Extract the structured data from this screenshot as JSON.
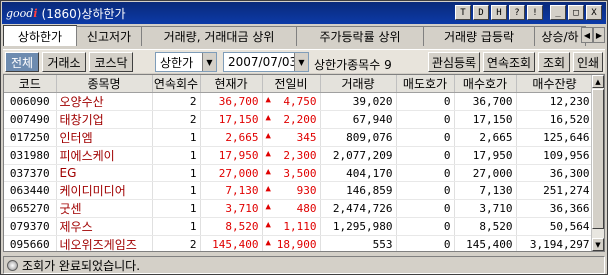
{
  "window": {
    "logo_prefix": "good",
    "logo_suffix": "i",
    "title": "(1860)상하한가",
    "buttons": [
      "T",
      "D",
      "H",
      "?",
      "!",
      "_",
      "□",
      "X"
    ]
  },
  "tabs": [
    {
      "label": "상하한가",
      "active": true
    },
    {
      "label": "신고저가",
      "active": false
    },
    {
      "label": "거래량, 거래대금 상위",
      "active": false
    },
    {
      "label": "주가등락률 상위",
      "active": false
    },
    {
      "label": "거래량 급등락",
      "active": false
    },
    {
      "label": "상승/하",
      "active": false
    }
  ],
  "toolbar": {
    "all": "전체",
    "kospi": "거래소",
    "kosdaq": "코스닥",
    "type_select": "상한가",
    "date": "2007/07/03",
    "count_label": "상한가종목수",
    "count_value": "9",
    "interest": "관심등록",
    "continuous": "연속조회",
    "query": "조회",
    "print": "인쇄"
  },
  "table": {
    "headers": [
      "코드",
      "종목명",
      "연속회수",
      "현재가",
      "전일비",
      "거래량",
      "매도호가",
      "매수호가",
      "매수잔량"
    ],
    "rows": [
      {
        "code": "006090",
        "name": "오양수산",
        "streak": "2",
        "price": "36,700",
        "change": "4,750",
        "volume": "39,020",
        "ask": "0",
        "bid": "36,700",
        "bid_qty": "12,230"
      },
      {
        "code": "007490",
        "name": "태창기업",
        "streak": "2",
        "price": "17,150",
        "change": "2,200",
        "volume": "67,940",
        "ask": "0",
        "bid": "17,150",
        "bid_qty": "16,520"
      },
      {
        "code": "017250",
        "name": "인터엠",
        "streak": "1",
        "price": "2,665",
        "change": "345",
        "volume": "809,076",
        "ask": "0",
        "bid": "2,665",
        "bid_qty": "125,646"
      },
      {
        "code": "031980",
        "name": "피에스케이",
        "streak": "1",
        "price": "17,950",
        "change": "2,300",
        "volume": "2,077,209",
        "ask": "0",
        "bid": "17,950",
        "bid_qty": "109,956"
      },
      {
        "code": "037370",
        "name": "EG",
        "streak": "1",
        "price": "27,000",
        "change": "3,500",
        "volume": "404,170",
        "ask": "0",
        "bid": "27,000",
        "bid_qty": "36,300"
      },
      {
        "code": "063440",
        "name": "케이디미디어",
        "streak": "1",
        "price": "7,130",
        "change": "930",
        "volume": "146,859",
        "ask": "0",
        "bid": "7,130",
        "bid_qty": "251,274"
      },
      {
        "code": "065270",
        "name": "굿센",
        "streak": "1",
        "price": "3,710",
        "change": "480",
        "volume": "2,474,726",
        "ask": "0",
        "bid": "3,710",
        "bid_qty": "36,366"
      },
      {
        "code": "079370",
        "name": "제우스",
        "streak": "1",
        "price": "8,520",
        "change": "1,110",
        "volume": "1,295,980",
        "ask": "0",
        "bid": "8,520",
        "bid_qty": "50,564"
      },
      {
        "code": "095660",
        "name": "네오위즈게임즈",
        "streak": "2",
        "price": "145,400",
        "change": "18,900",
        "volume": "553",
        "ask": "0",
        "bid": "145,400",
        "bid_qty": "3,194,297"
      }
    ]
  },
  "status": {
    "message": "조회가 완료되었습니다."
  },
  "colors": {
    "title_bar": "#0c3aa8",
    "up_red": "#e00000",
    "name_red": "#a00000",
    "dark_button": "#6e8cb0"
  }
}
